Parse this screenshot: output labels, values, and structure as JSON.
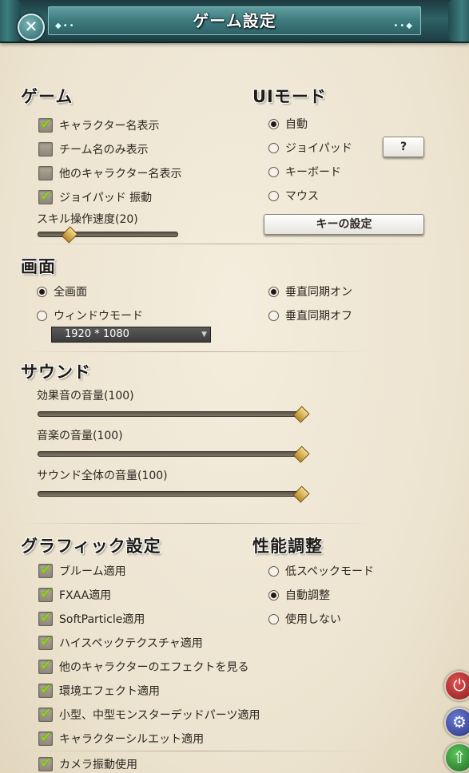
{
  "window": {
    "title": "ゲーム設定"
  },
  "game": {
    "title": "ゲーム",
    "options": [
      {
        "label": "キャラクター名表示",
        "checked": true
      },
      {
        "label": "チーム名のみ表示",
        "checked": false
      },
      {
        "label": "他のキャラクター名表示",
        "checked": false
      },
      {
        "label": "ジョイパッド 振動",
        "checked": true
      }
    ],
    "skill_speed": {
      "label": "スキル操作速度(20)",
      "value": 20
    }
  },
  "ui_mode": {
    "title": "UIモード",
    "options": [
      {
        "label": "自動",
        "selected": true
      },
      {
        "label": "ジョイパッド",
        "selected": false
      },
      {
        "label": "キーボード",
        "selected": false
      },
      {
        "label": "マウス",
        "selected": false
      }
    ],
    "help_label": "?",
    "key_settings_label": "キーの設定"
  },
  "screen": {
    "title": "画面",
    "modes": [
      {
        "label": "全画面",
        "selected": true
      },
      {
        "label": "ウィンドウモード",
        "selected": false
      }
    ],
    "resolution": "1920 * 1080",
    "vsync": [
      {
        "label": "垂直同期オン",
        "selected": true
      },
      {
        "label": "垂直同期オフ",
        "selected": false
      }
    ]
  },
  "sound": {
    "title": "サウンド",
    "sliders": [
      {
        "label": "効果音の音量(100)",
        "value": 100
      },
      {
        "label": "音楽の音量(100)",
        "value": 100
      },
      {
        "label": "サウンド全体の音量(100)",
        "value": 100
      }
    ]
  },
  "graphics": {
    "title": "グラフィック設定",
    "options": [
      {
        "label": "ブルーム適用",
        "checked": true
      },
      {
        "label": "FXAA適用",
        "checked": true
      },
      {
        "label": "SoftParticle適用",
        "checked": true
      },
      {
        "label": "ハイスペックテクスチャ適用",
        "checked": true
      },
      {
        "label": "他のキャラクターのエフェクトを見る",
        "checked": true
      },
      {
        "label": "環境エフェクト適用",
        "checked": true
      },
      {
        "label": "小型、中型モンスターデッドパーツ適用",
        "checked": true
      },
      {
        "label": "キャラクターシルエット適用",
        "checked": true
      },
      {
        "label": "カメラ振動使用",
        "checked": true
      }
    ]
  },
  "performance": {
    "title": "性能調整",
    "options": [
      {
        "label": "低スペックモード",
        "selected": false
      },
      {
        "label": "自動調整",
        "selected": true
      },
      {
        "label": "使用しない",
        "selected": false
      }
    ]
  },
  "side_buttons": [
    {
      "icon": "power-icon",
      "color": "#a32a2a"
    },
    {
      "icon": "gear-icon",
      "color": "#3a4a9a"
    },
    {
      "icon": "share-icon",
      "color": "#2f8a2f"
    }
  ]
}
